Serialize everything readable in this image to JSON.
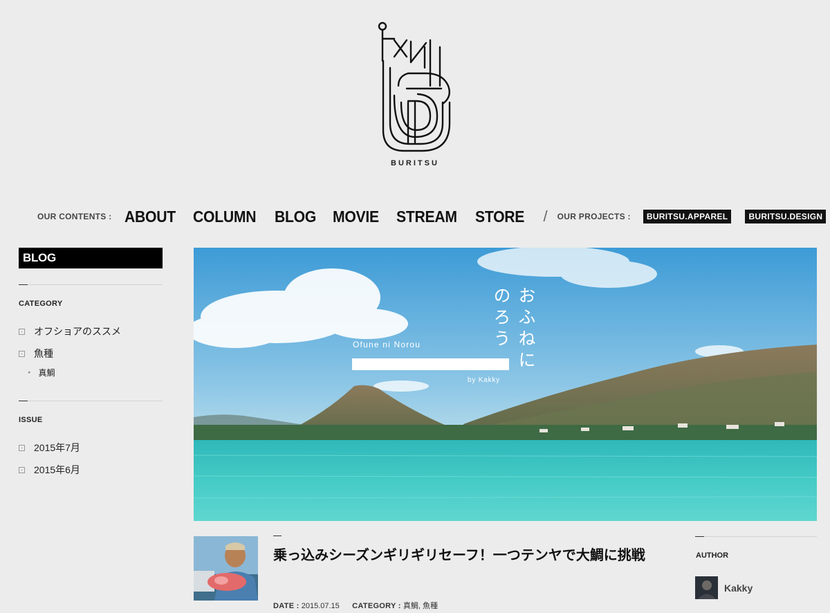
{
  "logo": {
    "wordmark": "BURITSU"
  },
  "nav": {
    "contents_caption": "OUR CONTENTS :",
    "links": [
      "ABOUT",
      "COLUMN",
      "BLOG",
      "MOVIE",
      "STREAM",
      "STORE"
    ],
    "separator": "/",
    "projects_caption": "OUR PROJECTS :",
    "projects": [
      "BURITSU.APPAREL",
      "BURITSU.DESIGN"
    ]
  },
  "sidebar": {
    "title": "BLOG",
    "category_heading": "CATEGORY",
    "categories": [
      {
        "label": "オフショアのススメ"
      },
      {
        "label": "魚種",
        "children": [
          "真鯛"
        ]
      }
    ],
    "issue_heading": "ISSUE",
    "issues": [
      "2015年7月",
      "2015年6月"
    ]
  },
  "hero": {
    "title_col1": "おふねに",
    "title_col2": "のろう",
    "title_en": "Ofune ni Norou",
    "byline": "by Kakky"
  },
  "post": {
    "title": "乗っ込みシーズンギリギリセーフ！一つテンヤで大鯛に挑戦",
    "date_label": "DATE :",
    "date": "2015.07.15",
    "category_label": "CATEGORY :",
    "categories": "真鯛, 魚種"
  },
  "author": {
    "heading": "AUTHOR",
    "name": "Kakky"
  },
  "colors": {
    "background": "#ececec",
    "ink": "#111111",
    "sea": "#3fc4c2",
    "sky": "#4aa6dc"
  }
}
